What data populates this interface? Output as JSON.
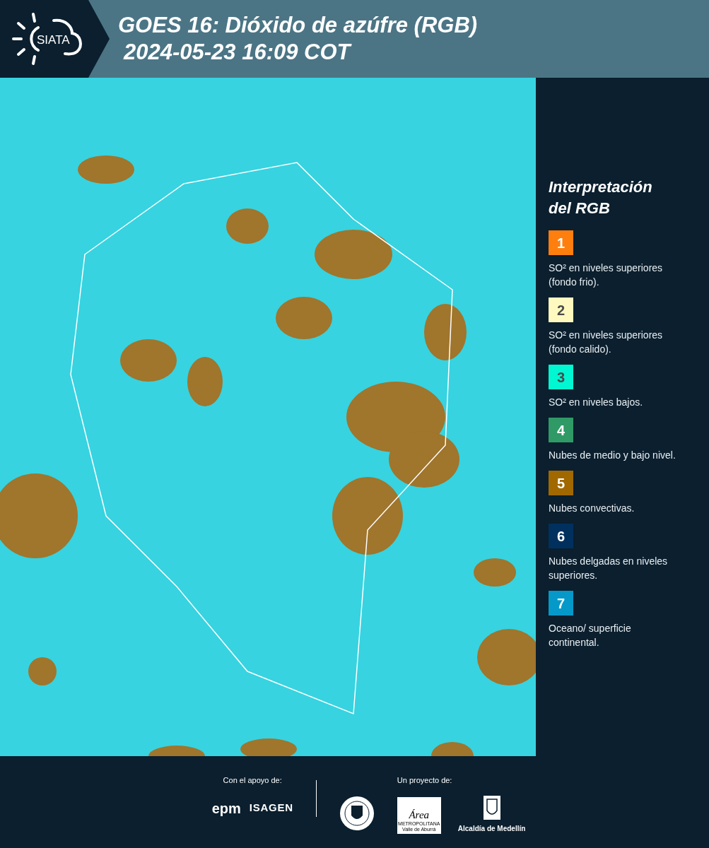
{
  "header": {
    "logo_text": "SIATA",
    "title": "GOES 16: Dióxido de azúfre (RGB)",
    "timestamp": "2024-05-23 16:09 COT"
  },
  "legend": {
    "title": "Interpretación del RGB",
    "items": [
      {
        "number": "1",
        "color": "#ff7f0e",
        "dark_number": false,
        "label": "SO² en niveles superiores (fondo frio)."
      },
      {
        "number": "2",
        "color": "#fff9c0",
        "dark_number": true,
        "label": "SO² en niveles superiores (fondo calido)."
      },
      {
        "number": "3",
        "color": "#00f7d2",
        "dark_number": true,
        "label": "SO² en niveles bajos."
      },
      {
        "number": "4",
        "color": "#2f9a66",
        "dark_number": false,
        "label": "Nubes de medio y bajo nivel."
      },
      {
        "number": "5",
        "color": "#a16800",
        "dark_number": false,
        "label": "Nubes convectivas."
      },
      {
        "number": "6",
        "color": "#00305e",
        "dark_number": false,
        "label": "Nubes delgadas en niveles superiores."
      },
      {
        "number": "7",
        "color": "#0599c9",
        "dark_number": false,
        "label": "Oceano/ superficie continental."
      }
    ]
  },
  "footer": {
    "support_label": "Con el apoyo de:",
    "support_logos": [
      "epm",
      "ISAGEN"
    ],
    "project_label": "Un proyecto de:",
    "area_logo": {
      "name": "Área",
      "line1": "METROPOLITANA",
      "line2": "Valle de Aburrá"
    },
    "city_logo": "Alcaldía de Medellín"
  }
}
